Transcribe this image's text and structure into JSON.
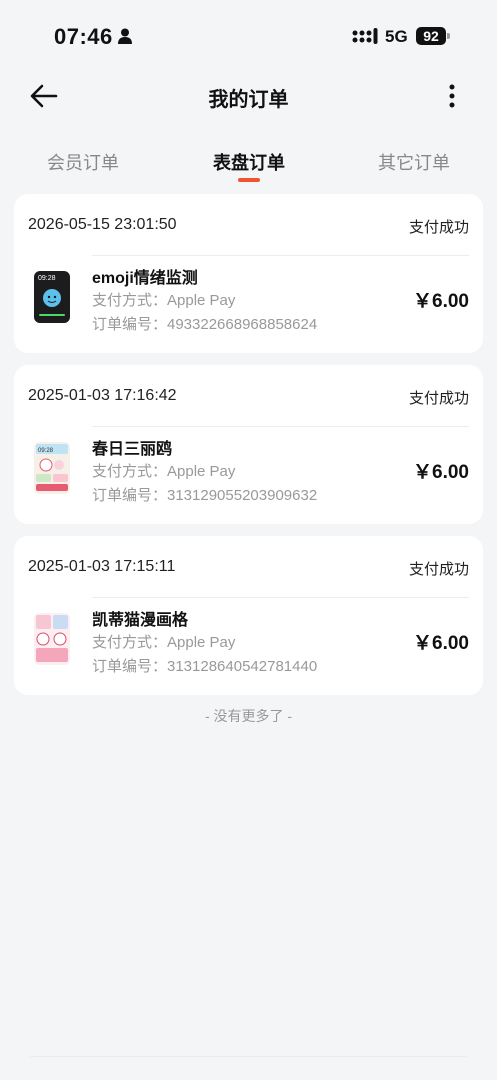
{
  "status_bar": {
    "time": "07:46",
    "network": "5G",
    "battery": "92"
  },
  "nav": {
    "title": "我的订单"
  },
  "tabs": [
    {
      "label": "会员订单",
      "active": false
    },
    {
      "label": "表盘订单",
      "active": true
    },
    {
      "label": "其它订单",
      "active": false
    }
  ],
  "orders": [
    {
      "date": "2026-05-15 23:01:50",
      "status": "支付成功",
      "name": "emoji情绪监测",
      "pay_method": "支付方式：Apple Pay",
      "order_no": "订单编号：493322668968858624",
      "price": "￥6.00",
      "thumb_icon": "emoji-watchface-thumbnail"
    },
    {
      "date": "2025-01-03 17:16:42",
      "status": "支付成功",
      "name": "春日三丽鸥",
      "pay_method": "支付方式：Apple Pay",
      "order_no": "订单编号：313129055203909632",
      "price": "￥6.00",
      "thumb_icon": "sanrio-watchface-thumbnail"
    },
    {
      "date": "2025-01-03 17:15:11",
      "status": "支付成功",
      "name": "凯蒂猫漫画格",
      "pay_method": "支付方式：Apple Pay",
      "order_no": "订单编号：313128640542781440",
      "price": "￥6.00",
      "thumb_icon": "hellokitty-watchface-thumbnail"
    }
  ],
  "footer": {
    "no_more": "- 没有更多了 -"
  },
  "colors": {
    "accent": "#f0532d",
    "background": "#f4f5f7",
    "muted_text": "#999999"
  }
}
